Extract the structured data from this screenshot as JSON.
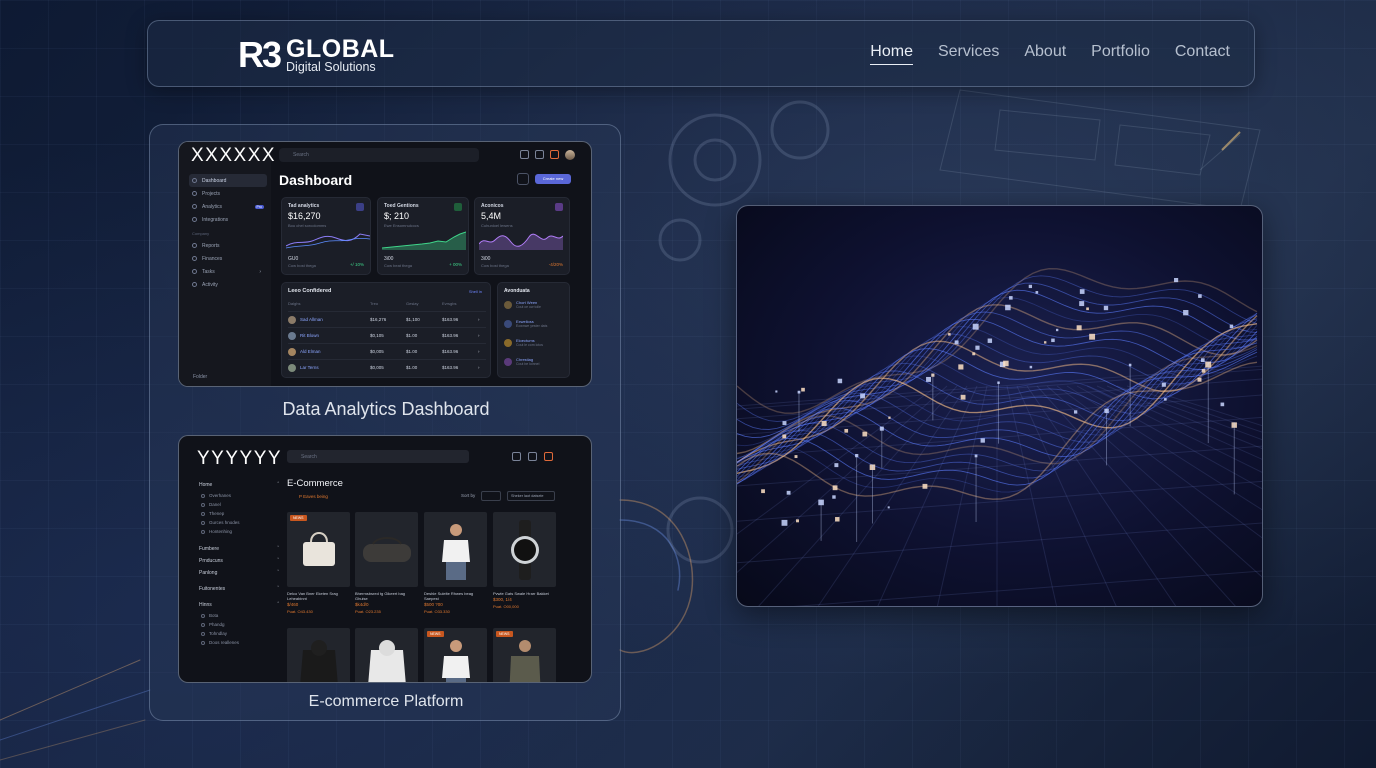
{
  "brand": {
    "mark": "R3",
    "name": "GLOBAL",
    "tagline": "Digital Solutions"
  },
  "nav": {
    "items": [
      {
        "label": "Home",
        "active": true
      },
      {
        "label": "Services",
        "active": false
      },
      {
        "label": "About",
        "active": false
      },
      {
        "label": "Portfolio",
        "active": false
      },
      {
        "label": "Contact",
        "active": false
      }
    ]
  },
  "portfolio": {
    "dashboard": {
      "caption": "Data Analytics Dashboard",
      "workspace": "XXXXXX",
      "search_placeholder": "Search",
      "title": "Dashboard",
      "action_button": "Create new",
      "sidebar": {
        "items": [
          "Dashboard",
          "Projects",
          "Analytics",
          "Integrations"
        ],
        "analytics_badge": "Pro",
        "section_label": "Company",
        "company_items": [
          "Reports",
          "Finances",
          "Tasks",
          "Activity"
        ],
        "footer": "Folder"
      },
      "cards": [
        {
          "label": "Tad analytics",
          "value": "$16,270",
          "sub": "Bou chel sorcolomms",
          "foot": "GU0",
          "foot_sub": "Cow bost thega",
          "delta": "+/ 10%",
          "accent": "#8b7cf6",
          "trend": "up"
        },
        {
          "label": "Toed Gentions",
          "value": "$; 210",
          "sub": "Ewe Ensomnulcocs",
          "foot": "3i00",
          "foot_sub": "Cow beat thega",
          "delta": "+ 00%",
          "accent": "#3fd68a",
          "trend": "up"
        },
        {
          "label": "Aconicos",
          "value": "5,4M",
          "sub": "Cuhunloel lewens",
          "foot": "3i00",
          "foot_sub": "Cow bost thega",
          "delta": "-4/20%",
          "accent": "#b07cf6",
          "trend": "wave"
        }
      ],
      "table": {
        "title": "Leeo Confidered",
        "link": "Shell in",
        "headers": [
          "Dalghs",
          "Treo",
          "Geslay",
          "Evrsgbs"
        ],
        "rows": [
          [
            "Sad Allman",
            "$16,276",
            "$1,100",
            "$163.96"
          ],
          [
            "Rit Blown",
            "$0,105",
            "$1.00",
            "$163.96"
          ],
          [
            "Ald Elman",
            "$0,005",
            "$1.00",
            "$163.96"
          ],
          [
            "Lar Terns",
            "$0,005",
            "$1.00",
            "$163.96"
          ]
        ]
      },
      "activity": {
        "title": "Avonduata",
        "items": [
          {
            "name": "Chort Ween",
            "sub": "Cout ce ow tolle"
          },
          {
            "name": "Exwelioss",
            "sub": "Eownwe yester dats"
          },
          {
            "name": "Eloectums",
            "sub": "Cout le com lotos"
          },
          {
            "name": "Chrestiag",
            "sub": "Cout be loinnel"
          }
        ]
      }
    },
    "ecommerce": {
      "caption": "E-commerce Platform",
      "workspace": "YYYYYY",
      "search_placeholder": "Search",
      "title": "E-Commerce",
      "breadcrumb": "P Eaves being",
      "sort_label": "Sort by",
      "category_select": "Sheker laot datsele",
      "sidebar": [
        {
          "group": "Home",
          "items": [
            "Overhanes",
            "Danel",
            "Thenep",
            "Gurces hnodes",
            "Hontenhing"
          ]
        },
        {
          "group": "Fumbere",
          "items": []
        },
        {
          "group": "Prnducuns",
          "items": []
        },
        {
          "group": "Panlong",
          "items": []
        },
        {
          "group": "Fuitonentes",
          "items": []
        },
        {
          "group": "Hinns",
          "items": [
            "Bota",
            "Phandg",
            "Tohndlay",
            "Doos reallenes"
          ]
        }
      ],
      "products": [
        {
          "name": "Delco Van Bner Eketen Srag Leheabinnt",
          "price": "$/460",
          "old": "Puat. O43.430",
          "tag": "NEWS",
          "kind": "handbag"
        },
        {
          "name": "Bhermsbsred tg Gikeert bag Ghuise",
          "price": "$k4d/0",
          "old": "Puat. O23.235",
          "tag": "",
          "kind": "duffel"
        },
        {
          "name": "Deshle Sulelte Rhwes beag Saepest",
          "price": "$500 ?00",
          "old": "Puat. O33.330",
          "tag": "",
          "kind": "tshirt"
        },
        {
          "name": "Pvwle Gats Swale Hrarr Bakket",
          "price": "$300, 1/4",
          "old": "Puat. O00,000",
          "tag": "",
          "kind": "watch"
        },
        {
          "name": "",
          "price": "",
          "old": "",
          "tag": "",
          "kind": "hoodie-dark"
        },
        {
          "name": "",
          "price": "",
          "old": "",
          "tag": "",
          "kind": "hoodie-light"
        },
        {
          "name": "",
          "price": "",
          "old": "",
          "tag": "NEWS",
          "kind": "tshirt"
        },
        {
          "name": "",
          "price": "",
          "old": "",
          "tag": "NEWS",
          "kind": "jacket"
        }
      ]
    }
  },
  "colors": {
    "accent_orange": "#e2792f",
    "accent_purple": "#5a67d8",
    "wave_blue": "#5c7cff",
    "wave_warm": "#ffc48a"
  }
}
